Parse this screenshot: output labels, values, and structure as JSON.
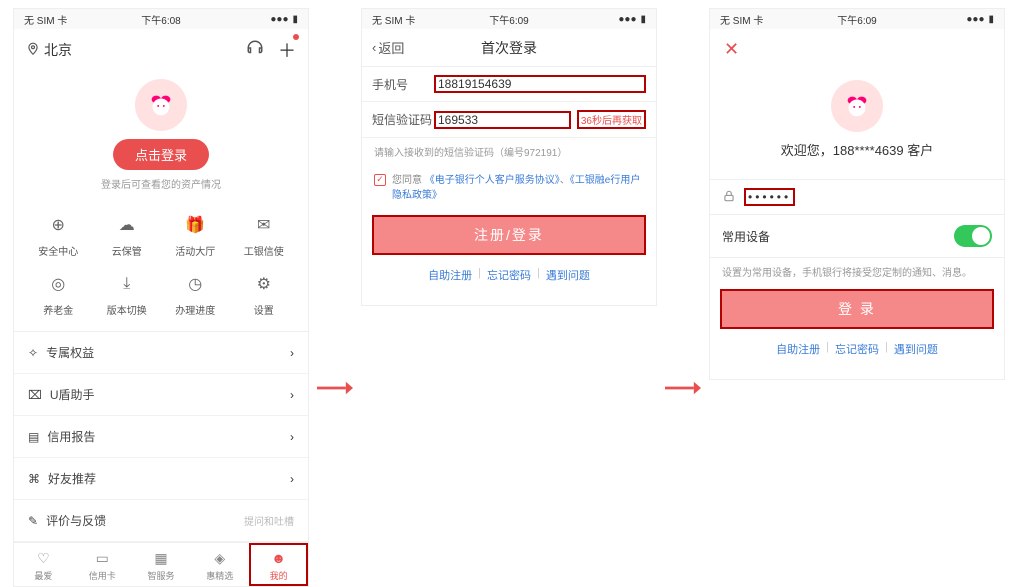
{
  "status": {
    "noSim": "无 SIM 卡",
    "wifi": "᯾",
    "time1": "下午6:08",
    "time2": "下午6:09",
    "time3": "下午6:09"
  },
  "s1": {
    "location": "北京",
    "loginBtn": "点击登录",
    "loginHint": "登录后可查看您的资产情况",
    "grid": [
      "安全中心",
      "云保管",
      "活动大厅",
      "工银信使",
      "养老金",
      "版本切换",
      "办理进度",
      "设置"
    ],
    "list": [
      "专属权益",
      "U盾助手",
      "信用报告",
      "好友推荐"
    ],
    "feedback": "评价与反馈",
    "feedbackHint": "提问和吐槽",
    "tabs": [
      "最爱",
      "信用卡",
      "智服务",
      "惠精选",
      "我的"
    ]
  },
  "s2": {
    "back": "返回",
    "title": "首次登录",
    "phoneLabel": "手机号",
    "phoneVal": "18819154639",
    "codeLabel": "短信验证码",
    "codeVal": "169533",
    "resend": "36秒后再获取",
    "smsHint": "请输入接收到的短信验证码（编号972191）",
    "agreePrefix": "您同意",
    "agreeLink1": "《电子银行个人客户服务协议》",
    "agreeSep": "、",
    "agreeLink2": "《工银融e行用户隐私政策》",
    "submit": "注册/登录",
    "links": [
      "自助注册",
      "忘记密码",
      "遇到问题"
    ]
  },
  "s3": {
    "welcome": "欢迎您，188****4639 客户",
    "pwd": "••••••",
    "devLabel": "常用设备",
    "devHint": "设置为常用设备，手机银行将接受您定制的通知、消息。",
    "submit": "登 录",
    "links": [
      "自助注册",
      "忘记密码",
      "遇到问题"
    ]
  }
}
